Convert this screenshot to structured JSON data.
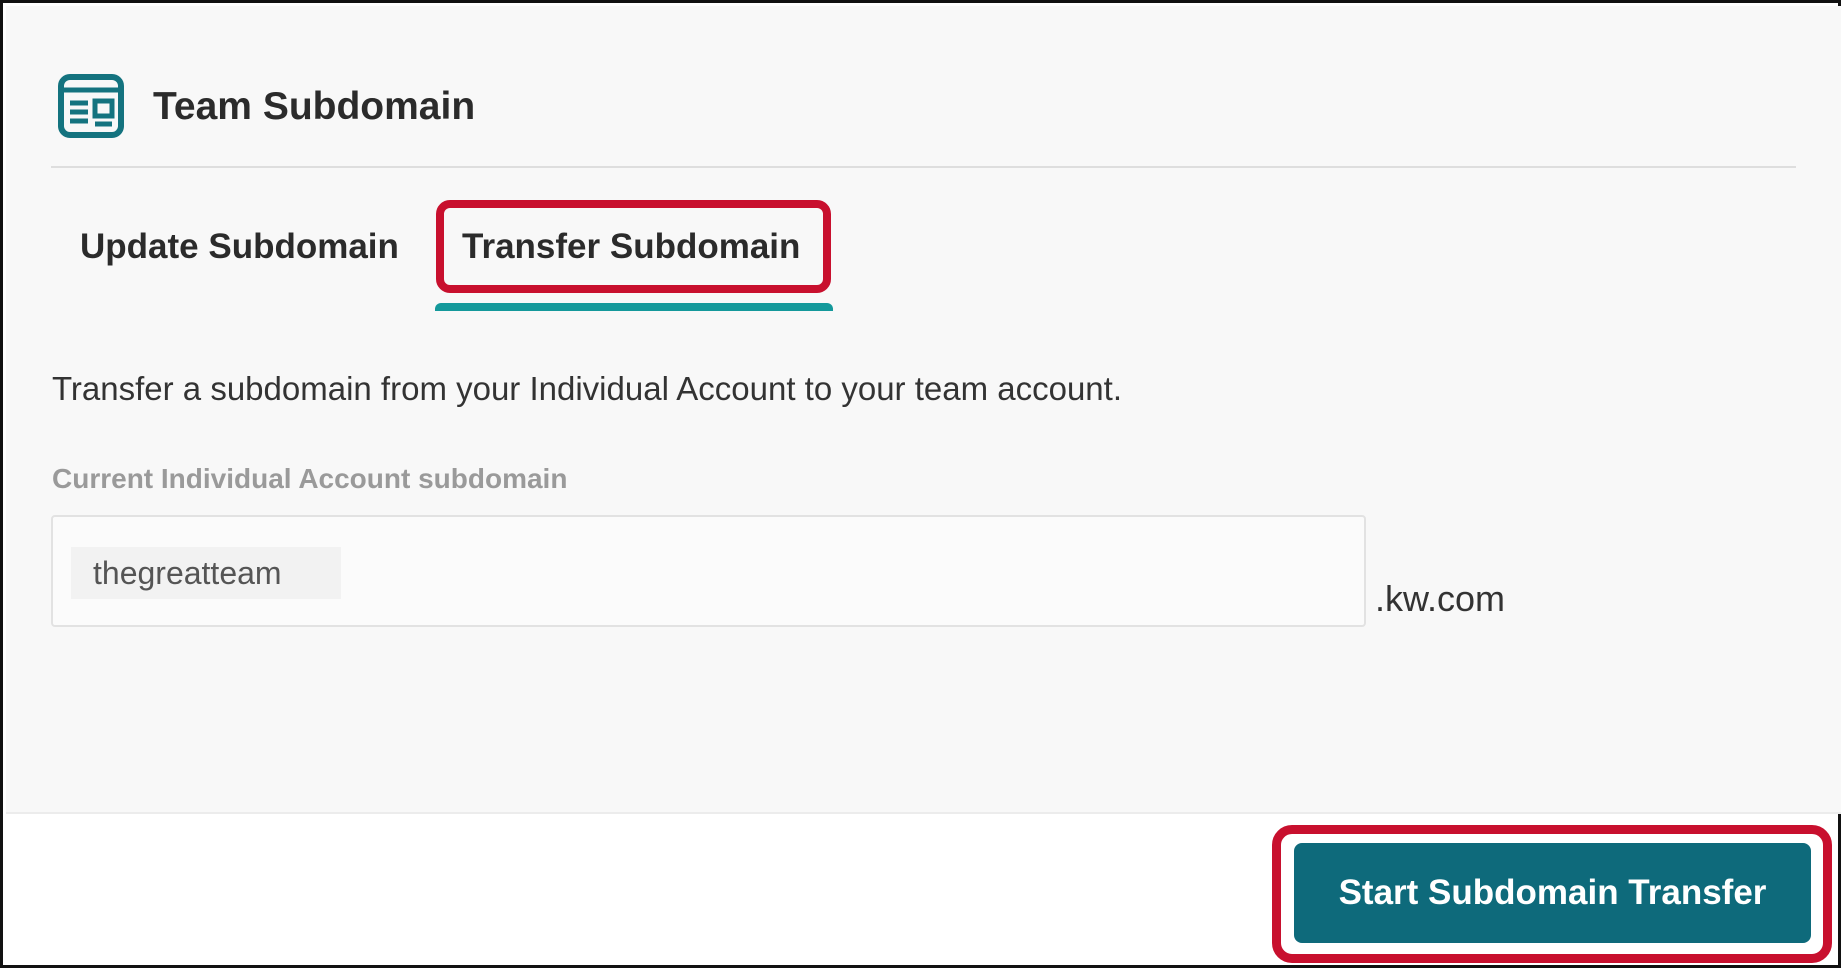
{
  "header": {
    "title": "Team Subdomain",
    "icon": "id-card-icon",
    "icon_color": "#14737f"
  },
  "tabs": [
    {
      "label": "Update Subdomain",
      "active": false
    },
    {
      "label": "Transfer Subdomain",
      "active": true
    }
  ],
  "transfer": {
    "description": "Transfer a subdomain from your Individual Account to your team account.",
    "field_label": "Current Individual Account subdomain",
    "current_subdomain": "thegreatteam",
    "domain_suffix": ".kw.com"
  },
  "footer": {
    "start_button_label": "Start Subdomain Transfer"
  },
  "colors": {
    "primary_button": "#0e6a7b",
    "tab_underline": "#14999b",
    "highlight_annotation": "#c8102e"
  }
}
